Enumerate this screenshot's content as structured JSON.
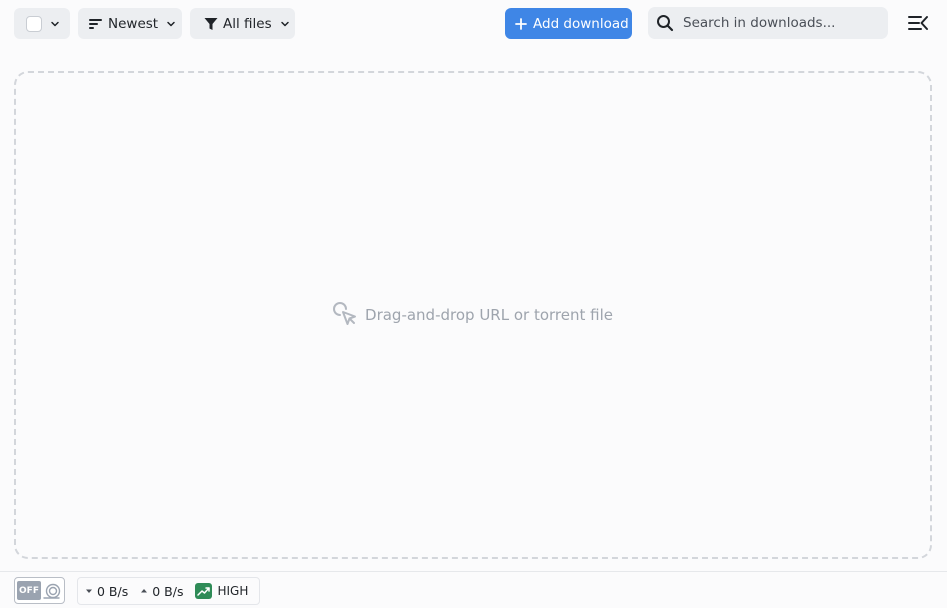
{
  "toolbar": {
    "sort_label": "Newest",
    "filter_label": "All files",
    "add_label": "Add download",
    "search_placeholder": "Search in downloads...",
    "icons": {
      "select": "checkbox-icon",
      "sort": "sort-lines-icon",
      "filter": "funnel-icon",
      "add": "plus-icon",
      "search": "magnifier-icon",
      "menu": "collapse-menu-icon"
    }
  },
  "dropzone": {
    "text": "Drag-and-drop URL or torrent file",
    "icon": "cursor-click-icon"
  },
  "statusbar": {
    "speed_limit_state": "OFF",
    "download_speed": "0 B/s",
    "upload_speed": "0 B/s",
    "priority": "HIGH"
  },
  "colors": {
    "accent": "#3f86e6",
    "priority_high": "#2e8b57",
    "muted_text": "#9ea4ad"
  }
}
